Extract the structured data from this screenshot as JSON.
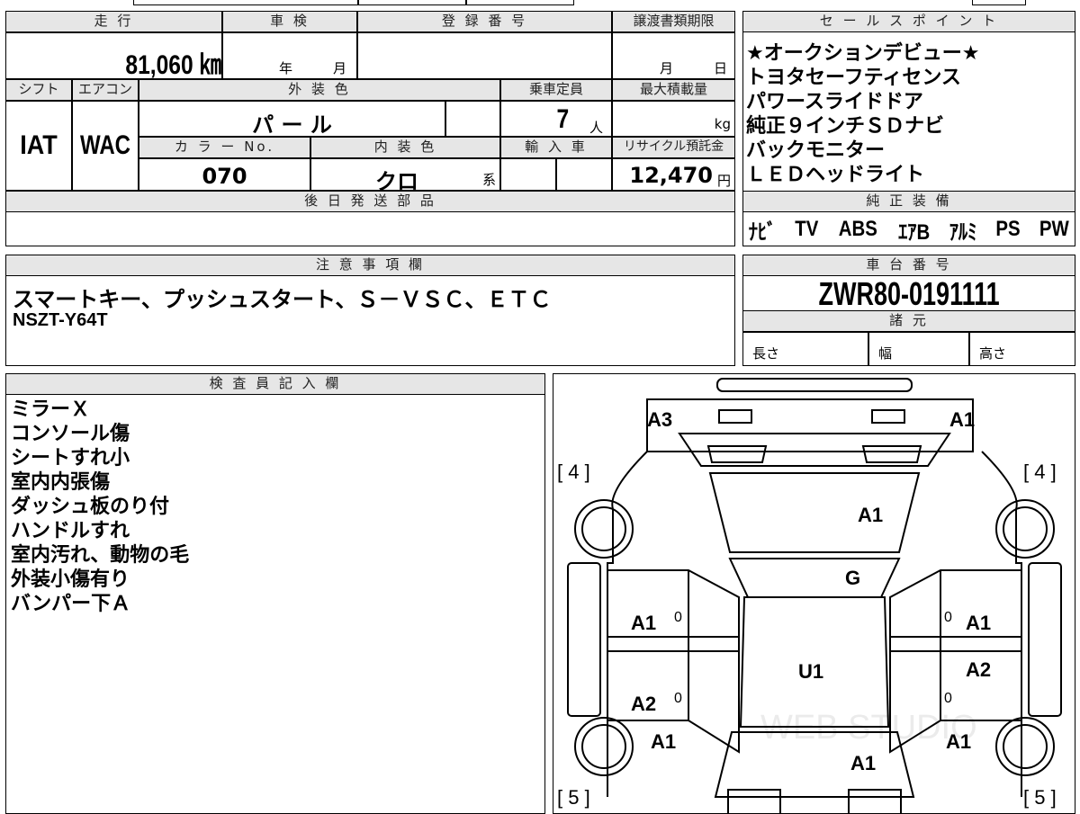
{
  "header_row": {
    "mileage_label": "走 行",
    "mileage_value": "81,060 ㎞",
    "inspection_label": "車 検",
    "inspection_year": "年",
    "inspection_month": "月",
    "registration_label": "登 録 番 号",
    "transfer_label": "譲渡書類期限",
    "transfer_month": "月",
    "transfer_day": "日"
  },
  "row2": {
    "shift_label": "シフト",
    "shift_value": "IAT",
    "ac_label": "エアコン",
    "ac_value": "WAC",
    "ext_color_label": "外 装 色",
    "ext_color_value": "パ ー ル",
    "capacity_label": "乗車定員",
    "capacity_value": "7",
    "capacity_unit": "人",
    "max_load_label": "最大積載量",
    "max_load_unit": "kg",
    "color_no_label": "カ ラ ー No.",
    "color_no_value": "070",
    "int_color_label": "内 装 色",
    "int_color_value": "クロ",
    "int_color_suffix": "系",
    "import_label": "輸 入 車",
    "recycle_label": "リサイクル預託金",
    "recycle_value": "12,470",
    "recycle_unit": "円"
  },
  "later_parts": {
    "label": "後 日 発 送 部 品"
  },
  "sales_points": {
    "label": "セ ー ル ス ポ イ ン ト",
    "items": [
      "★オークションデビュー★",
      "トヨタセーフティセンス",
      "パワースライドドア",
      "純正９インチＳＤナビ",
      "バックモニター",
      "ＬＥＤヘッドライト"
    ]
  },
  "genuine_equipment": {
    "label": "純 正 装 備",
    "items": [
      "ﾅﾋﾞ",
      "TV",
      "ABS",
      "ｴｱB",
      "ｱﾙﾐ",
      "PS",
      "PW"
    ]
  },
  "notes": {
    "label": "注 意 事 項 欄",
    "line1": "スマートキー、プッシュスタート、Ｓ－ＶＳＣ、ＥＴＣ",
    "line2": "NSZT-Y64T"
  },
  "chassis": {
    "label": "車 台 番 号",
    "value": "ZWR80-0191111",
    "spec_label": "諸 元",
    "length_label": "長さ",
    "width_label": "幅",
    "height_label": "高さ"
  },
  "inspector": {
    "label": "検 査 員 記 入 欄",
    "lines": [
      "ミラーＸ",
      "コンソール傷",
      "シートすれ小",
      "室内内張傷",
      "ダッシュ板のり付",
      "ハンドルすれ",
      "室内汚れ、動物の毛",
      "外装小傷有り",
      "バンパー下Ａ"
    ]
  },
  "diagram": {
    "labels": {
      "rear_left": "A3",
      "rear_right": "A1",
      "tyre_rl": "[ 4 ]",
      "tyre_rr": "[ 4 ]",
      "roof_rear": "A1",
      "glass": "G",
      "door_rl_upper": "A1",
      "door_rr_upper": "A1",
      "door_rl_lower": "A2",
      "door_rr_lower": "A2",
      "roof": "U1",
      "fender_fl": "A1",
      "fender_fr": "A1",
      "hood": "A1",
      "tyre_fl": "[ 5 ]",
      "tyre_fr": "[ 5 ]",
      "mark0_a": "0",
      "mark0_b": "0",
      "mark0_c": "0",
      "mark0_d": "0"
    },
    "watermark": "WEB STUDIO"
  }
}
